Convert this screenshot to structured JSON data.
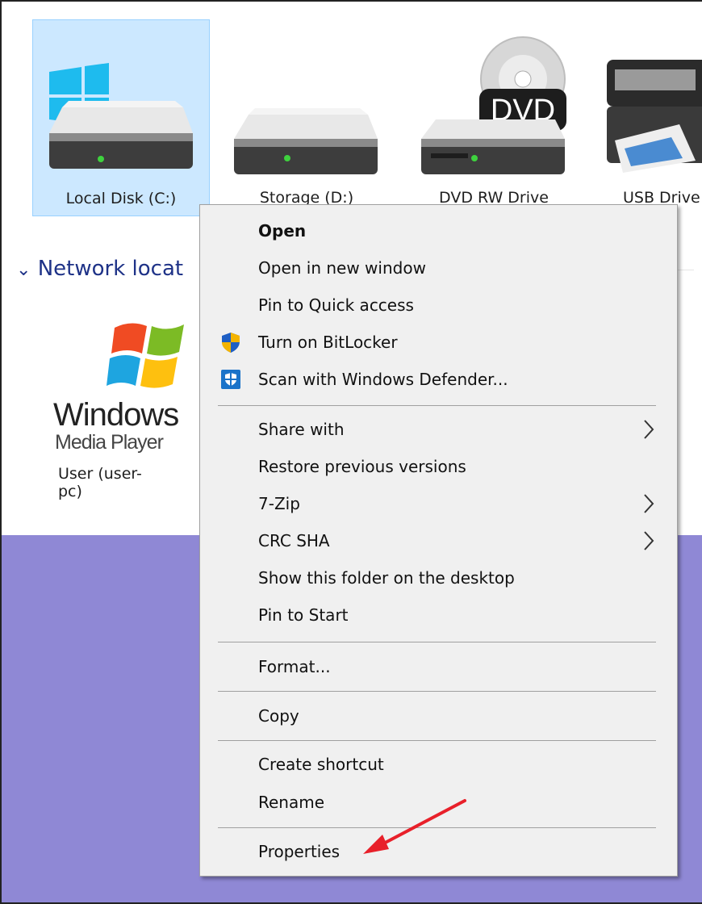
{
  "drives": [
    {
      "label": "Local Disk (C:)",
      "icon": "windows-drive-icon",
      "selected": true
    },
    {
      "label": "Storage (D:)",
      "icon": "hard-drive-icon"
    },
    {
      "label": "DVD RW Drive",
      "icon": "dvd-drive-icon",
      "badge": "DVD"
    },
    {
      "label": "USB Drive",
      "icon": "printer-drive-icon"
    }
  ],
  "network": {
    "header": "Network locat",
    "item": {
      "logo_word": "Windows",
      "logo_sub": "Media Player",
      "label": "User (user-pc)"
    }
  },
  "context_menu": {
    "items": [
      {
        "label": "Open",
        "bold": true
      },
      {
        "label": "Open in new window"
      },
      {
        "label": "Pin to Quick access"
      },
      {
        "label": "Turn on BitLocker",
        "icon": "uac-shield-icon"
      },
      {
        "label": "Scan with Windows Defender...",
        "icon": "windows-defender-icon"
      },
      {
        "label": "Share with",
        "submenu": true
      },
      {
        "label": "Restore previous versions"
      },
      {
        "label": "7-Zip",
        "submenu": true
      },
      {
        "label": "CRC SHA",
        "submenu": true
      },
      {
        "label": "Show this folder on the desktop"
      },
      {
        "label": "Pin to Start"
      },
      {
        "label": "Format..."
      },
      {
        "label": "Copy"
      },
      {
        "label": "Create shortcut"
      },
      {
        "label": "Rename"
      },
      {
        "label": "Properties"
      }
    ]
  },
  "colors": {
    "selection": "#cce8ff",
    "desktop": "#8f88d5",
    "arrow": "#e8202a",
    "header": "#1e3287"
  }
}
